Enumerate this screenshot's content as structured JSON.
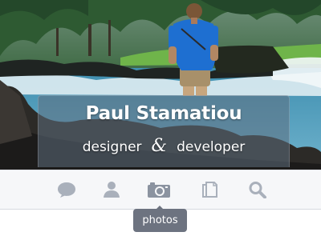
{
  "profile": {
    "name": "Paul Stamatiou",
    "role_1": "designer",
    "ampersand": "&",
    "role_2": "developer"
  },
  "nav": {
    "items": [
      {
        "icon": "chat-bubble-icon",
        "active": false
      },
      {
        "icon": "person-icon",
        "active": false
      },
      {
        "icon": "camera-icon",
        "active": true
      },
      {
        "icon": "document-icon",
        "active": false
      },
      {
        "icon": "search-icon",
        "active": false
      }
    ],
    "tooltip": "photos"
  },
  "colors": {
    "icon_inactive": "#a9b0bb",
    "icon_active": "#8b93a0",
    "tooltip_bg": "#6d7380"
  }
}
